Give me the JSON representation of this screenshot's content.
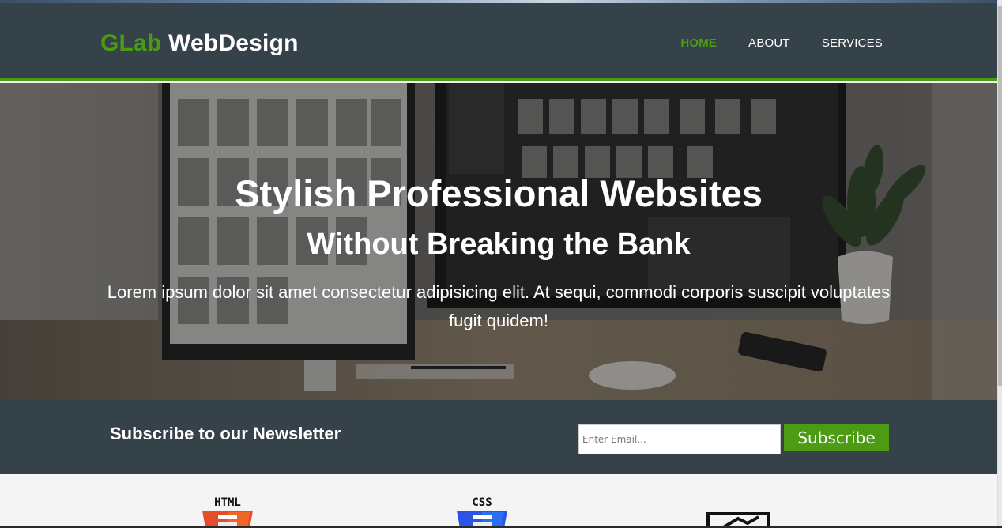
{
  "header": {
    "brand_highlight": "GLab",
    "brand_rest": " WebDesign",
    "nav": [
      {
        "label": "HOME",
        "current": true
      },
      {
        "label": "ABOUT",
        "current": false
      },
      {
        "label": "SERVICES",
        "current": false
      }
    ]
  },
  "showcase": {
    "title": "Stylish Professional Websites",
    "subtitle": "Without Breaking the Bank",
    "text": "Lorem ipsum dolor sit amet consectetur adipisicing elit. At sequi, commodi corporis suscipit voluptates fugit quidem!"
  },
  "newsletter": {
    "title": "Subscribe to our Newsletter",
    "email_placeholder": "Enter Email...",
    "button_label": "Subscribe"
  },
  "boxes": [
    {
      "icon": "html5-logo",
      "label": "HTML"
    },
    {
      "icon": "css3-logo",
      "label": "CSS"
    },
    {
      "icon": "brush-icon",
      "label": ""
    }
  ],
  "colors": {
    "accent": "#4c9b14",
    "dark": "#35424a",
    "light_bg": "#f4f4f4",
    "html_orange": "#e44d26",
    "css_blue": "#2d53e5"
  }
}
